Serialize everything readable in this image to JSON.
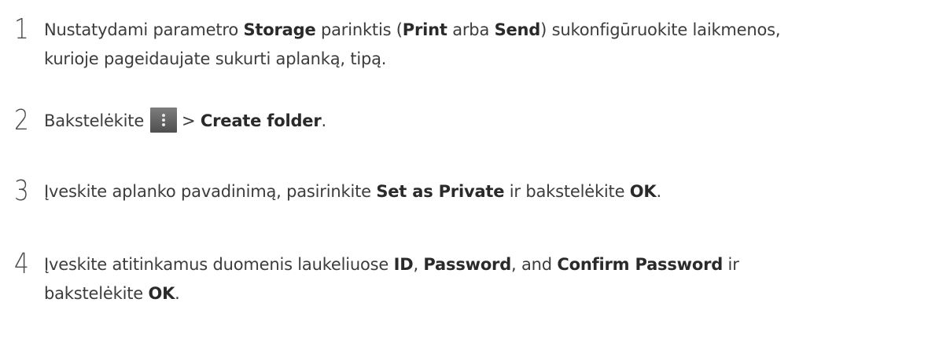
{
  "steps": [
    {
      "number": "1",
      "t1": "Nustatydami parametro ",
      "b1": "Storage",
      "t2": " parinktis (",
      "b2": "Print",
      "t3": " arba ",
      "b3": "Send",
      "t4": ") sukonfigūruokite laikmenos,",
      "line2": "kurioje pageidaujate sukurti aplanką, tipą."
    },
    {
      "number": "2",
      "t1": "Bakstelėkite",
      "menu_icon": "more-vertical-icon",
      "t2": "> ",
      "b1": "Create folder",
      "t3": "."
    },
    {
      "number": "3",
      "t1": "Įveskite aplanko pavadinimą, pasirinkite ",
      "b1": "Set as Private",
      "t2": " ir bakstelėkite ",
      "b2": "OK",
      "t3": "."
    },
    {
      "number": "4",
      "t1": "Įveskite atitinkamus duomenis laukeliuose ",
      "b1": "ID",
      "t2": ", ",
      "b2": "Password",
      "t3": ", and ",
      "b3": "Confirm Password",
      "t4": " ir",
      "t5": "bakstelėkite ",
      "b4": "OK",
      "t6": "."
    }
  ]
}
